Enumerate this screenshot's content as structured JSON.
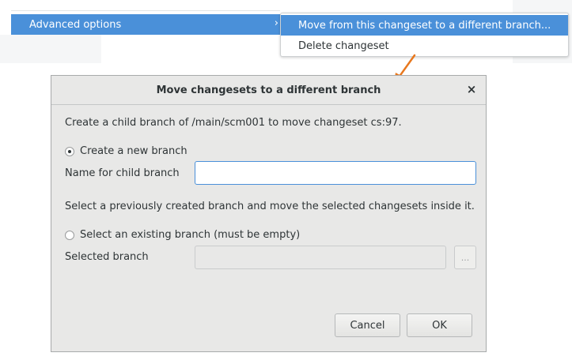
{
  "context_menu": {
    "advanced_options_label": "Advanced options",
    "submenu_chevron": "›",
    "submenu": {
      "move_label": "Move from this changeset to a different branch...",
      "delete_label": "Delete changeset"
    }
  },
  "dialog": {
    "title": "Move changesets to a different branch",
    "close_glyph": "×",
    "description": "Create a child branch of /main/scm001 to move changeset cs:97.",
    "new_branch": {
      "radio_label": "Create a new branch",
      "selected": true,
      "name_label": "Name for child branch",
      "name_value": ""
    },
    "existing_hint": "Select a previously created branch and move the selected changesets inside it.",
    "existing_branch": {
      "radio_label": "Select an existing branch (must be empty)",
      "selected": false,
      "selected_label": "Selected branch",
      "selected_value": "",
      "browse_label": "..."
    },
    "buttons": {
      "cancel": "Cancel",
      "ok": "OK"
    }
  },
  "colors": {
    "accent": "#4a90d9",
    "arrow": "#e8781e"
  }
}
